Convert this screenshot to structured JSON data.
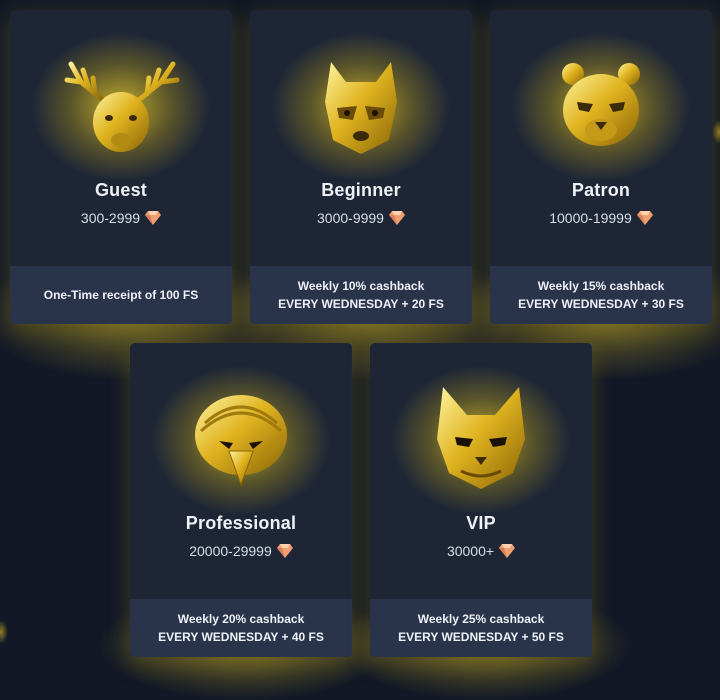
{
  "tiers": [
    {
      "name": "Guest",
      "range": "300-2999",
      "perk_line1": "One-Time receipt of 100 FS",
      "perk_line2": "",
      "mask_icon": "deer-mask-icon"
    },
    {
      "name": "Beginner",
      "range": "3000-9999",
      "perk_line1": "Weekly 10% cashback",
      "perk_line2": "EVERY WEDNESDAY + 20 FS",
      "mask_icon": "raccoon-mask-icon"
    },
    {
      "name": "Patron",
      "range": "10000-19999",
      "perk_line1": "Weekly 15% cashback",
      "perk_line2": "EVERY WEDNESDAY + 30 FS",
      "mask_icon": "panther-mask-icon"
    },
    {
      "name": "Professional",
      "range": "20000-29999",
      "perk_line1": "Weekly 20% cashback",
      "perk_line2": "EVERY WEDNESDAY + 40 FS",
      "mask_icon": "eagle-mask-icon"
    },
    {
      "name": "VIP",
      "range": "30000+",
      "perk_line1": "Weekly 25% cashback",
      "perk_line2": "EVERY WEDNESDAY + 50 FS",
      "mask_icon": "cat-mask-icon"
    }
  ],
  "currency_icon": "diamond-icon",
  "colors": {
    "background": "#121826",
    "card": "#1e2636",
    "card_footer": "#29334a",
    "gold": "#d9b21f",
    "gem": "#f0a070"
  }
}
